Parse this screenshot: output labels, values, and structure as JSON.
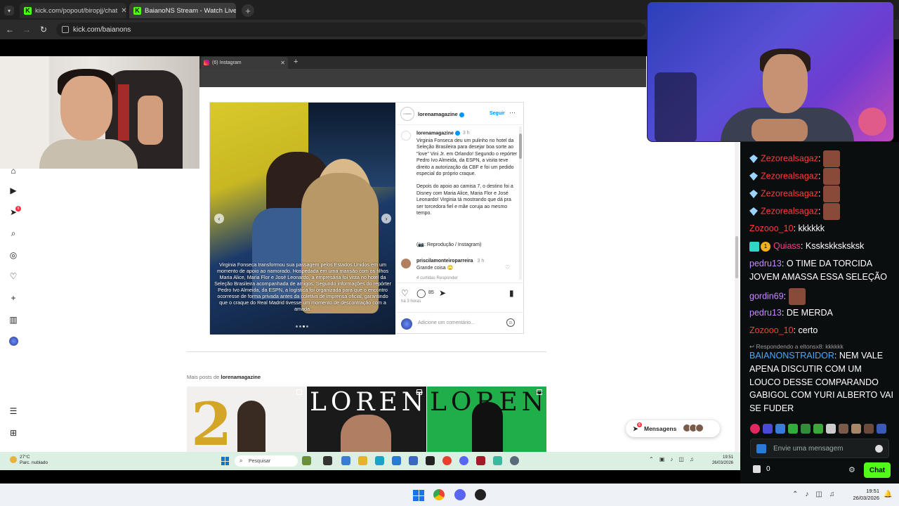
{
  "browser": {
    "tabs": [
      {
        "label": "kick.com/popout/biropjj/chat",
        "active": false
      },
      {
        "label": "BaianoNS Stream - Watch Live",
        "active": true
      }
    ],
    "url": "kick.com/baianons"
  },
  "instagram_window": {
    "tab_label": "(6) Instagram",
    "nav_badge": "6"
  },
  "post": {
    "username": "lorenamagazine",
    "follow_label": "Seguir",
    "avatar_text": "LORENA",
    "caption_time": "3 h",
    "caption": "Virginia Fonseca deu um pulinho no hotel da Seleção Brasileira para desejar boa sorte ao \"love\" Vini Jr. em Orlando! Segundo o repórter Pedro Ivo Almeida, da ESPN, a visita teve direito a autorização da CBF e foi um pedido especial do próprio craque.",
    "caption_2": "Depois do apoio ao camisa 7, o destino foi a Disney com Maria Alice, Maria Flor e José Leonardo! Virginia tá mostrando que dá pra ser torcedora fiel e mãe coruja ao mesmo tempo.",
    "source": "(📷: Reprodução / Instagram)",
    "image_caption": "Virginia Fonseca transformou sua passagem pelos Estados Unidos em um momento de apoio ao namorado. Hospedada em uma mansão com os filhos Maria Alice, Maria Flor e José Leonardo, a empresária foi vista no hotel da Seleção Brasileira acompanhada de amigos. Segundo informações do repórter Pedro Ivo Almeida, da ESPN, a logística foi organizada para que o encontro ocorresse de forma privada antes da coletiva de imprensa oficial, garantindo que o craque do Real Madrid tivesse um momento de descontração com a amada.",
    "comment": {
      "user": "priscilamonteiroparreira",
      "time": "3 h",
      "text": "Grande coisa 🙄",
      "meta": "4 curtidas   Responder"
    },
    "comment_count": "85",
    "posted_ago": "há 3 horas",
    "comment_placeholder": "Adicione um comentário..."
  },
  "more_posts": {
    "prefix": "Mais posts de ",
    "user": "lorenamagazine",
    "thumb_text": "LORENA",
    "thumb1_text": "2"
  },
  "messages_label": "Mensagens",
  "messages_badge": "6",
  "inner_taskbar": {
    "weather_temp": "27°C",
    "weather_desc": "Parc. nublado",
    "search_placeholder": "Pesquisar",
    "time": "19:51",
    "date": "26/03/2026"
  },
  "chat": {
    "messages": [
      {
        "user": "Zezorealsagaz",
        "text": "",
        "user_color": "#ff3b3b",
        "emote": true
      },
      {
        "user": "Zezorealsagaz",
        "text": "",
        "user_color": "#ff3b3b",
        "emote": true
      },
      {
        "user": "Zezorealsagaz",
        "text": "",
        "user_color": "#ff3b3b",
        "emote": true
      },
      {
        "user": "Zezorealsagaz",
        "text": "",
        "user_color": "#ff3b3b",
        "emote": true
      },
      {
        "user": "Zozooo_10",
        "text": "kkkkkk",
        "user_color": "#ff3b3b"
      },
      {
        "user": "Quiass",
        "text": "Ksskskksksksk",
        "user_color": "#ff3b8a"
      },
      {
        "user": "pedru13",
        "text": "O TIME DA TORCIDA JOVEM AMASSA ESSA SELEÇÃO",
        "user_color": "#c98bff"
      },
      {
        "user": "gordin69",
        "text": "",
        "user_color": "#c98bff",
        "emote": true
      },
      {
        "user": "pedru13",
        "text": "DE MERDA",
        "user_color": "#c98bff"
      },
      {
        "user": "Zozooo_10",
        "text": "certo",
        "user_color": "#ff3b3b"
      },
      {
        "user": "BAIANONSTRAIDOR",
        "text": "NEM VALE APENA DISCUTIR COM UM LOUCO DESSE COMPARANDO GABIGOL COM YURI ALBERTO VAI SE FUDER",
        "user_color": "#4aa8ff"
      }
    ],
    "reply_to": "↩ Respondendo a eltonsx8: kkkkkk",
    "input_placeholder": "Envie uma mensagem",
    "points": "0",
    "send_label": "Chat"
  },
  "host_taskbar": {
    "time": "19:51",
    "date": "26/03/2026"
  }
}
